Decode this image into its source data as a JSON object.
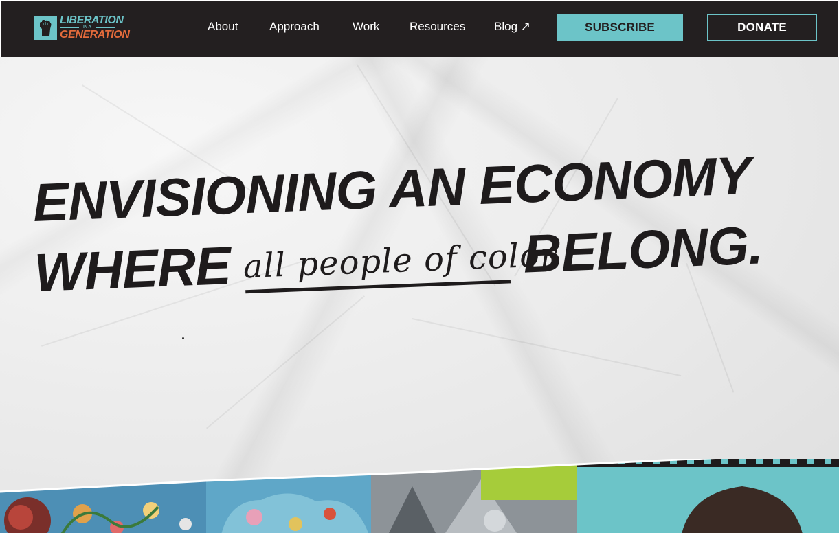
{
  "brand": {
    "logo_line1": "LIBERATION",
    "logo_line2": "IN A",
    "logo_line3": "GENERATION",
    "colors": {
      "teal": "#6cc4c8",
      "orange": "#e36b3b",
      "dark": "#231f20"
    },
    "logo_icon": "raised-fist-icon"
  },
  "nav": {
    "items": [
      {
        "label": "About"
      },
      {
        "label": "Approach"
      },
      {
        "label": "Work"
      },
      {
        "label": "Resources"
      },
      {
        "label": "Blog ↗"
      }
    ],
    "subscribe_label": "SUBSCRIBE",
    "donate_label": "DONATE"
  },
  "hero": {
    "line1": "ENVISIONING AN ECONOMY",
    "line2_start": "WHERE",
    "line2_script": "all people of color",
    "line2_end": "BELONG."
  }
}
